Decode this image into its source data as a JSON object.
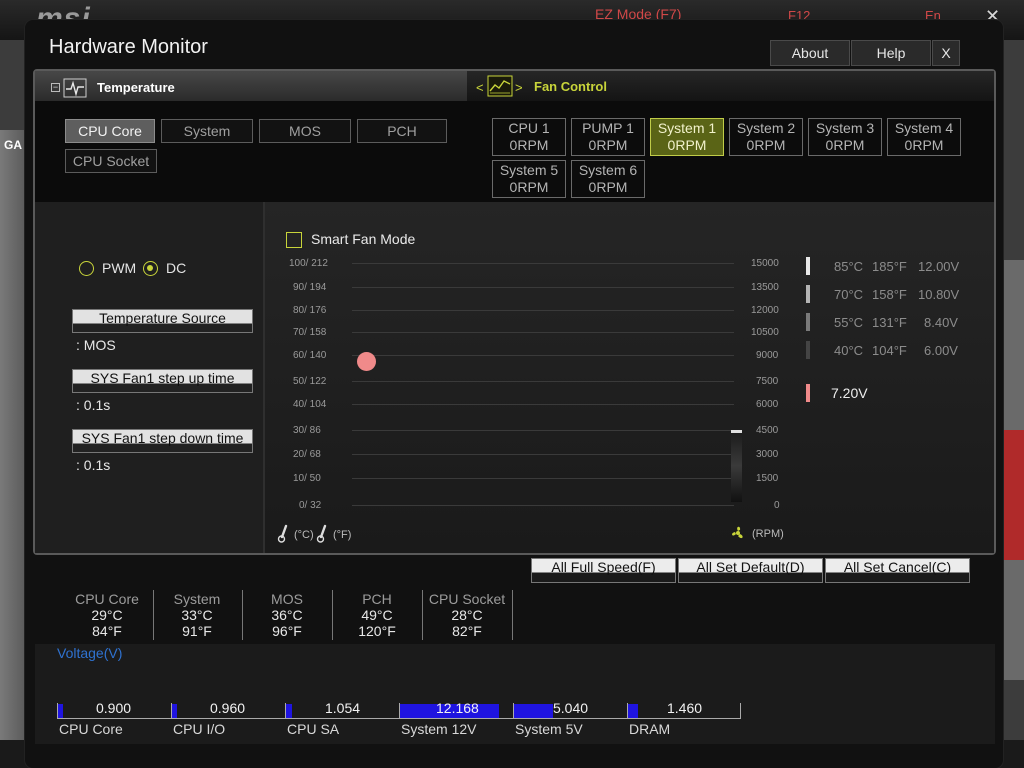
{
  "background": {
    "logo": "msi",
    "ez_mode": "EZ Mode (F7)",
    "f12": "F12",
    "lang": "En",
    "close": "✕",
    "left_label": "GA"
  },
  "dialog": {
    "title": "Hardware Monitor",
    "about": "About",
    "help": "Help",
    "close": "X"
  },
  "temperature": {
    "title": "Temperature",
    "collapse": "−",
    "sources": [
      "CPU Core",
      "System",
      "MOS",
      "PCH",
      "CPU Socket"
    ],
    "selected": "CPU Core"
  },
  "fan_control": {
    "title": "Fan Control",
    "prev": "<",
    "next": ">",
    "fans": [
      {
        "name": "CPU 1",
        "rpm": "0RPM"
      },
      {
        "name": "PUMP 1",
        "rpm": "0RPM"
      },
      {
        "name": "System 1",
        "rpm": "0RPM"
      },
      {
        "name": "System 2",
        "rpm": "0RPM"
      },
      {
        "name": "System 3",
        "rpm": "0RPM"
      },
      {
        "name": "System 4",
        "rpm": "0RPM"
      },
      {
        "name": "System 5",
        "rpm": "0RPM"
      },
      {
        "name": "System 6",
        "rpm": "0RPM"
      }
    ],
    "selected": "System 1"
  },
  "fan_settings": {
    "pwm": "PWM",
    "dc": "DC",
    "mode": "DC",
    "temp_source_label": "Temperature Source",
    "temp_source_value": ": MOS",
    "step_up_label": "SYS Fan1 step up time",
    "step_up_value": ": 0.1s",
    "step_down_label": "SYS Fan1 step down time",
    "step_down_value": ": 0.1s"
  },
  "graph": {
    "smart_fan_mode": "Smart Fan Mode",
    "smart_fan_checked": false,
    "y_left": [
      "100/ 212",
      "90/ 194",
      "80/ 176",
      "70/ 158",
      "60/ 140",
      "50/ 122",
      "40/ 104",
      "30/ 86",
      "20/ 68",
      "10/ 50",
      "0/ 32"
    ],
    "y_right": [
      "15000",
      "13500",
      "12000",
      "10500",
      "9000",
      "7500",
      "6000",
      "4500",
      "3000",
      "1500",
      "0"
    ],
    "point_temp_c": 59,
    "legend": [
      {
        "c": "85°C",
        "f": "185°F",
        "v": "12.00V",
        "color": "#e8e8e8"
      },
      {
        "c": "70°C",
        "f": "158°F",
        "v": "10.80V",
        "color": "#b4b4b4"
      },
      {
        "c": "55°C",
        "f": "131°F",
        "v": "8.40V",
        "color": "#7a7a7a"
      },
      {
        "c": "40°C",
        "f": "104°F",
        "v": "6.00V",
        "color": "#444444"
      }
    ],
    "current_voltage": "7.20V",
    "current_color": "#f08a8a",
    "unit_c": "(°C)",
    "unit_f": "(°F)",
    "unit_rpm": "(RPM)"
  },
  "actions": {
    "full_speed": "All Full Speed(F)",
    "set_default": "All Set Default(D)",
    "set_cancel": "All Set Cancel(C)"
  },
  "sensors": [
    {
      "name": "CPU Core",
      "c": "29°C",
      "f": "84°F"
    },
    {
      "name": "System",
      "c": "33°C",
      "f": "91°F"
    },
    {
      "name": "MOS",
      "c": "36°C",
      "f": "96°F"
    },
    {
      "name": "PCH",
      "c": "49°C",
      "f": "120°F"
    },
    {
      "name": "CPU Socket",
      "c": "28°C",
      "f": "82°F"
    }
  ],
  "voltage": {
    "title": "Voltage(V)",
    "rails": [
      {
        "name": "CPU Core",
        "value": "0.900",
        "fill_ratio": 0.05
      },
      {
        "name": "CPU I/O",
        "value": "0.960",
        "fill_ratio": 0.05
      },
      {
        "name": "CPU SA",
        "value": "1.054",
        "fill_ratio": 0.05
      },
      {
        "name": "System 12V",
        "value": "12.168",
        "fill_ratio": 0.9
      },
      {
        "name": "System 5V",
        "value": "5.040",
        "fill_ratio": 0.35
      },
      {
        "name": "DRAM",
        "value": "1.460",
        "fill_ratio": 0.09
      }
    ]
  }
}
